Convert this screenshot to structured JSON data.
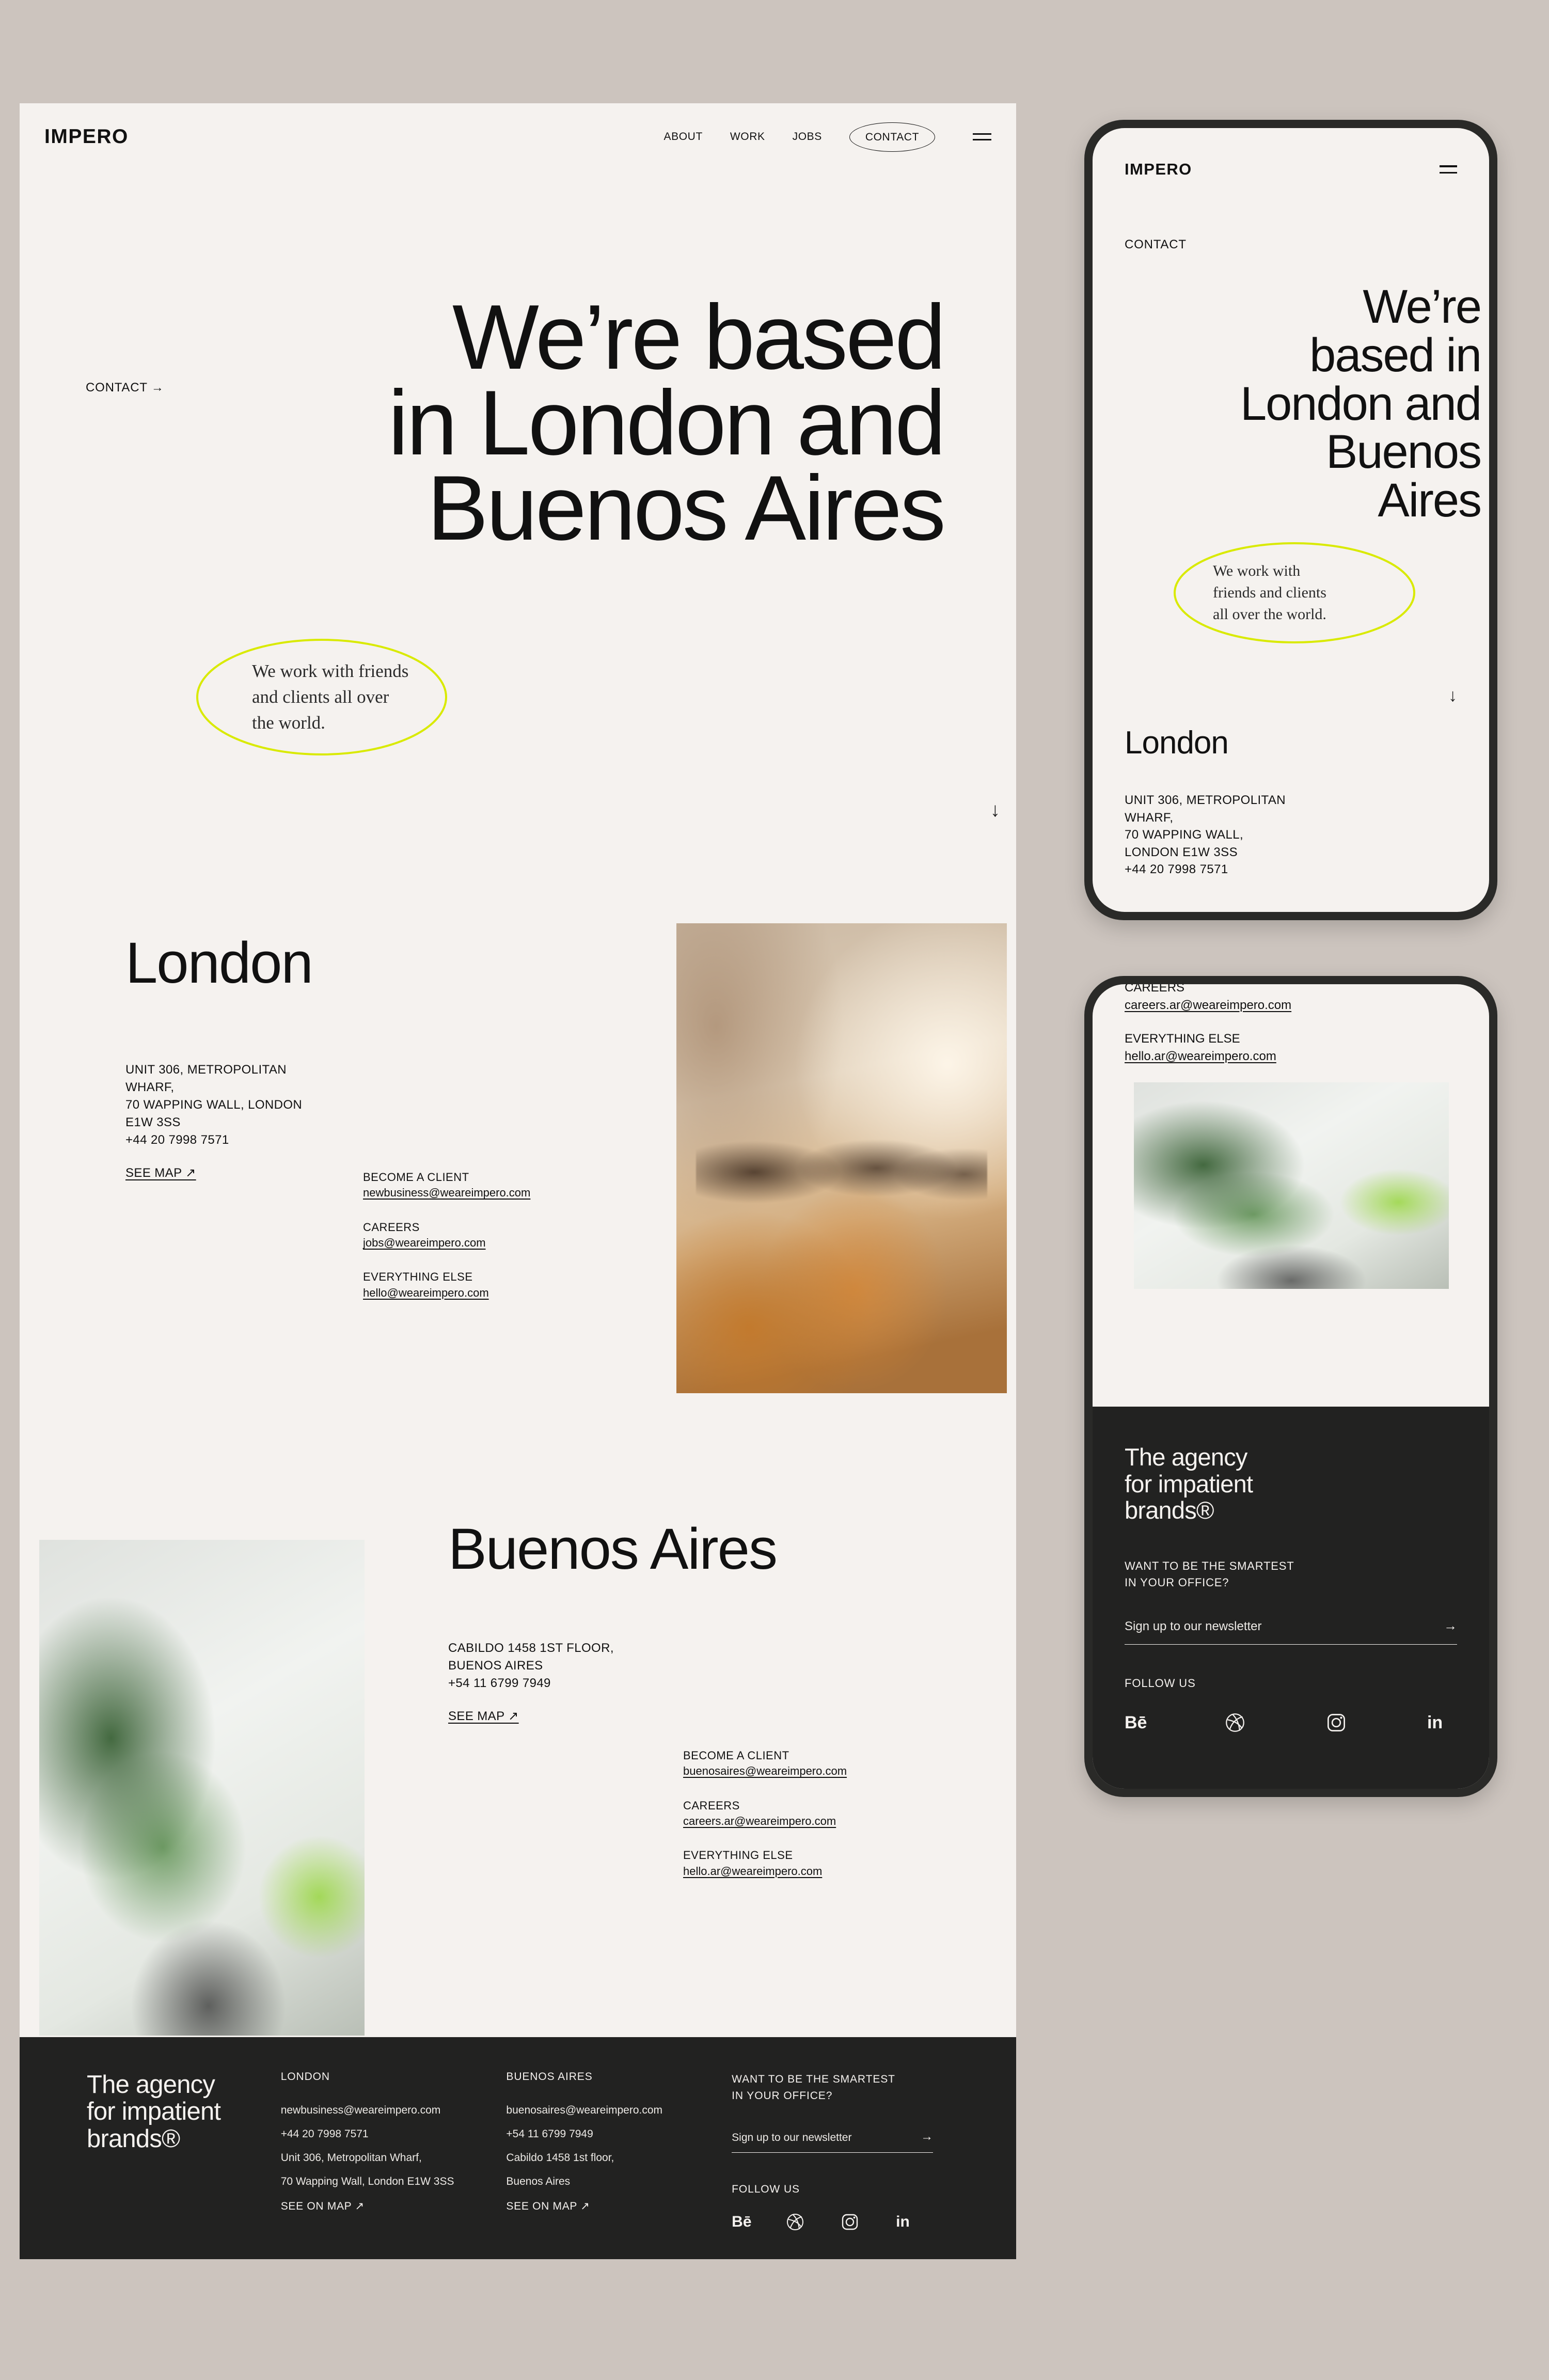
{
  "brand": {
    "logo": "IMPERO"
  },
  "colors": {
    "page_bg": "#F5F2EF",
    "canvas_bg": "#CCC4BE",
    "dark": "#222221",
    "accent_lime": "#D9EA00"
  },
  "desktop": {
    "nav": {
      "links": [
        "ABOUT",
        "WORK",
        "JOBS"
      ],
      "pill": "CONTACT",
      "menu_icon": "hamburger-icon"
    },
    "hero": {
      "eyebrow": "CONTACT →",
      "line1": "We’re based",
      "line2": "in London and",
      "line3": "Buenos Aires"
    },
    "highlight": {
      "line1": "We work with friends",
      "line2": "and clients all over",
      "line3": "the world."
    },
    "scroll_arrow": "↓",
    "london": {
      "title": "London",
      "address_lines": [
        "UNIT 306, METROPOLITAN",
        "WHARF,",
        "70 WAPPING WALL, LONDON",
        "E1W 3SS",
        "+44 20 7998 7571"
      ],
      "map_link": "SEE MAP ↗",
      "contacts": [
        {
          "label": "BECOME A CLIENT",
          "email": "newbusiness@weareimpero.com"
        },
        {
          "label": "CAREERS",
          "email": "jobs@weareimpero.com"
        },
        {
          "label": "EVERYTHING ELSE",
          "email": "hello@weareimpero.com"
        }
      ]
    },
    "buenos_aires": {
      "title": "Buenos Aires",
      "address_lines": [
        "CABILDO 1458 1ST FLOOR,",
        "BUENOS AIRES",
        "+54 11 6799 7949"
      ],
      "map_link": "SEE MAP ↗",
      "contacts": [
        {
          "label": "BECOME A CLIENT",
          "email": "buenosaires@weareimpero.com"
        },
        {
          "label": "CAREERS",
          "email": "careers.ar@weareimpero.com"
        },
        {
          "label": "EVERYTHING ELSE",
          "email": "hello.ar@weareimpero.com"
        }
      ]
    },
    "footer": {
      "brand_line1": "The agency",
      "brand_line2": "for impatient",
      "brand_line3": "brands®",
      "london": {
        "heading": "LONDON",
        "email": "newbusiness@weareimpero.com",
        "phone": "+44 20 7998 7571",
        "addr1": "Unit 306, Metropolitan Wharf,",
        "addr2": "70 Wapping Wall, London E1W 3SS",
        "map": "SEE ON MAP ↗"
      },
      "buenos_aires": {
        "heading": "BUENOS AIRES",
        "email": "buenosaires@weareimpero.com",
        "phone": "+54 11 6799 7949",
        "addr1": "Cabildo 1458 1st floor,",
        "addr2": "Buenos Aires",
        "map": "SEE ON MAP ↗"
      },
      "newsletter": {
        "heading_line1": "WANT TO BE THE SMARTEST",
        "heading_line2": "IN YOUR OFFICE?",
        "placeholder": "Sign up to our newsletter",
        "submit_arrow": "→"
      },
      "follow_label": "FOLLOW US",
      "socials": [
        "behance-icon",
        "dribbble-icon",
        "instagram-icon",
        "linkedin-icon"
      ],
      "behance_glyph": "Bē",
      "linkedin_glyph": "in"
    }
  },
  "phone1": {
    "logo": "IMPERO",
    "menu_icon": "hamburger-icon",
    "eyebrow": "CONTACT",
    "hero_line1": "We’re",
    "hero_line2": "based in",
    "hero_line3": "London and",
    "hero_line4": "Buenos",
    "hero_line5": "Aires",
    "highlight_line1": "We work with",
    "highlight_line2": "friends and clients",
    "highlight_line3": "all over the world.",
    "scroll_arrow": "↓",
    "london_title": "London",
    "london_address_lines": [
      "UNIT 306, METROPOLITAN",
      "WHARF,",
      "70 WAPPING WALL,",
      "LONDON E1W 3SS",
      "+44 20 7998 7571"
    ]
  },
  "phone2": {
    "careers_label": "CAREERS",
    "careers_email": "careers.ar@weareimpero.com",
    "everything_label": "EVERYTHING ELSE",
    "everything_email": "hello.ar@weareimpero.com",
    "footer": {
      "brand_line1": "The agency",
      "brand_line2": "for impatient",
      "brand_line3": "brands®",
      "q_line1": "WANT TO BE THE SMARTEST",
      "q_line2": "IN YOUR OFFICE?",
      "placeholder": "Sign up to our newsletter",
      "submit_arrow": "→",
      "follow_label": "FOLLOW US",
      "behance_glyph": "Bē",
      "linkedin_glyph": "in"
    }
  }
}
